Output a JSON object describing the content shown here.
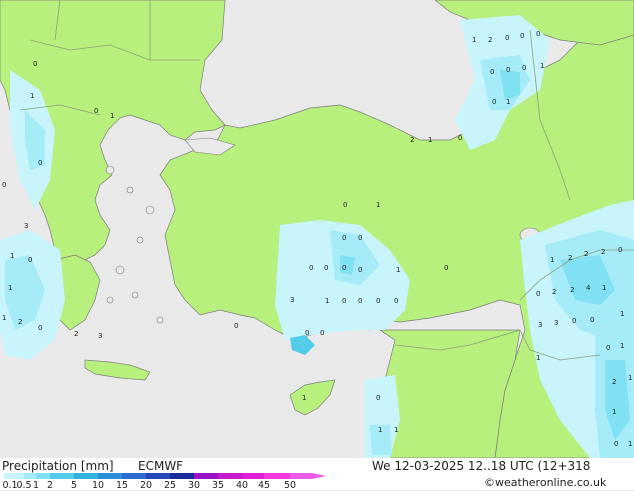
{
  "title": "Precipitation [mm]",
  "model": "ECMWF",
  "valid_time": "We 12-03-2025 12..18 UTC (12+318",
  "credit": "©weatheronline.co.uk",
  "legend": {
    "labels": [
      "0.1",
      "0.5",
      "1",
      "2",
      "5",
      "10",
      "15",
      "20",
      "25",
      "30",
      "35",
      "40",
      "45",
      "50"
    ],
    "colors": [
      "#c8f4fb",
      "#a6ecf8",
      "#7fe1f2",
      "#52cce9",
      "#33b2de",
      "#2a8fd6",
      "#2b6bd0",
      "#2346b8",
      "#1a2c9a",
      "#9b13c9",
      "#c61ad1",
      "#e01fd8",
      "#f03ae0",
      "#e85ce8"
    ]
  },
  "colors": {
    "land": "#b7f07d",
    "sea": "#e9e9e9",
    "border": "#8aa07a",
    "coast": "#6f6f6f"
  },
  "map_values": [
    "0",
    "1",
    "0",
    "0",
    "1",
    "0",
    "1",
    "2",
    "1",
    "0",
    "1",
    "2",
    "0",
    "0",
    "0",
    "0",
    "0",
    "0",
    "1",
    "0",
    "1",
    "0",
    "1",
    "2",
    "1",
    "0",
    "0",
    "1",
    "0",
    "0",
    "0",
    "0",
    "0",
    "0",
    "1",
    "0",
    "3",
    "1",
    "0",
    "0",
    "0",
    "0",
    "0",
    "0",
    "0",
    "1",
    "2",
    "2",
    "2",
    "0",
    "0",
    "2",
    "2",
    "4",
    "1",
    "1",
    "3",
    "3",
    "0",
    "0",
    "1",
    "0",
    "1",
    "2",
    "1",
    "0",
    "1",
    "1",
    "1",
    "1",
    "0",
    "1",
    "3",
    "3",
    "2"
  ]
}
